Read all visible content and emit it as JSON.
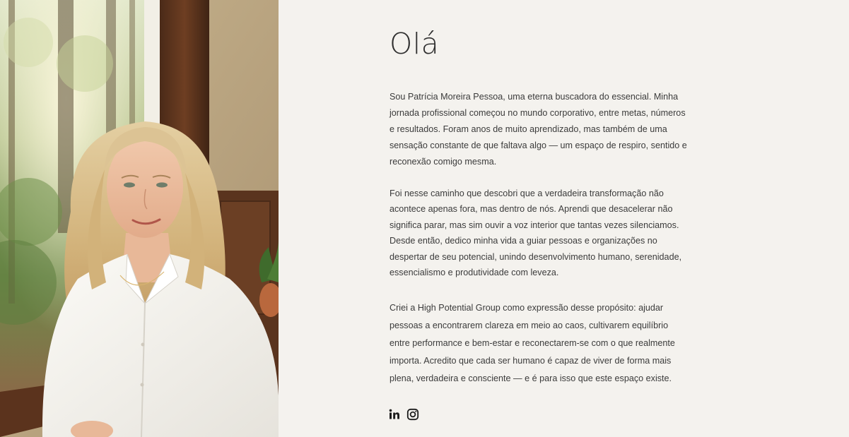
{
  "about": {
    "heading": "Olá",
    "paragraphs": [
      "Sou Patrícia Moreira Pessoa, uma eterna buscadora do essencial. Minha jornada profissional começou no mundo corporativo, entre metas, números e resultados. Foram anos de muito aprendizado, mas também de uma sensação constante de que faltava algo — um espaço de respiro, sentido e reconexão comigo mesma.",
      "Foi nesse caminho que descobri que a verdadeira transformação não acontece apenas fora, mas dentro de nós. Aprendi que desacelerar não significa parar, mas sim ouvir a voz interior que tantas vezes silenciamos. Desde então, dedico minha vida a guiar pessoas e organizações no despertar de seu potencial, unindo desenvolvimento humano, serenidade, essencialismo e produtividade com leveza.",
      "Criei a High Potential Group como expressão desse propósito: ajudar pessoas a encontrarem clareza em meio ao caos, cultivarem equilíbrio entre performance e bem-estar e reconectarem-se com o que realmente importa. Acredito que cada ser humano é capaz de viver de forma mais plena, verdadeira e consciente — e é para isso que este espaço existe."
    ]
  },
  "social": {
    "links": [
      {
        "icon": "linkedin-icon"
      },
      {
        "icon": "instagram-icon"
      }
    ]
  },
  "colors": {
    "background": "#f4f2ee",
    "text": "#3b3b3b",
    "heading": "#2f2f2f",
    "icon": "#1c1c1c"
  }
}
